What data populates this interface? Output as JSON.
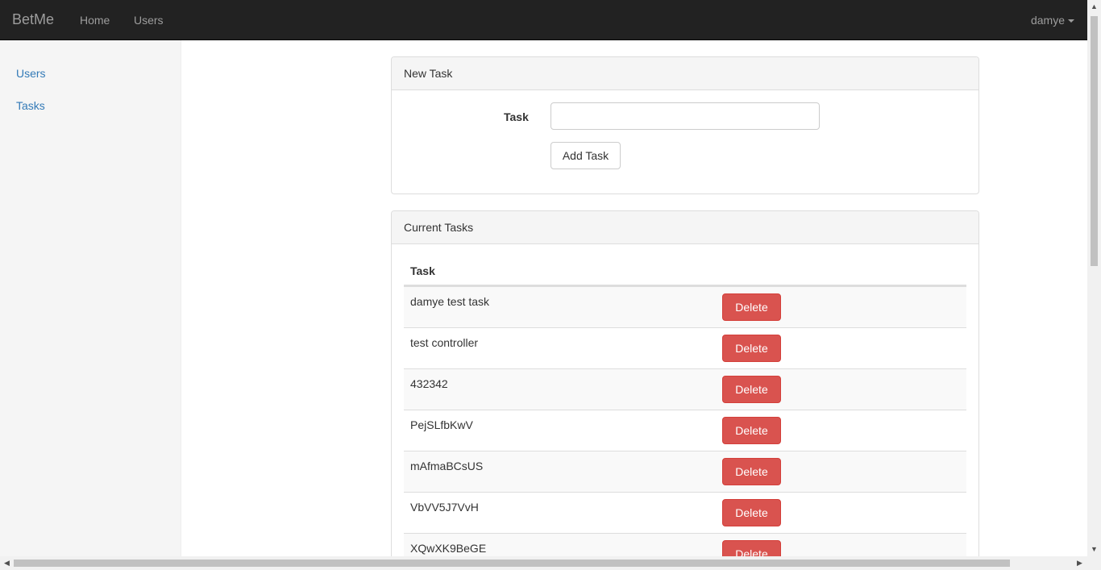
{
  "navbar": {
    "brand": "BetMe",
    "links": [
      "Home",
      "Users"
    ],
    "user": "damye"
  },
  "sidebar": {
    "items": [
      "Users",
      "Tasks"
    ]
  },
  "new_task_panel": {
    "heading": "New Task",
    "label": "Task",
    "input_value": "",
    "button": "Add Task"
  },
  "current_tasks_panel": {
    "heading": "Current Tasks",
    "column": "Task",
    "delete_label": "Delete",
    "rows": [
      "damye test task",
      "test controller",
      "432342",
      "PejSLfbKwV",
      "mAfmaBCsUS",
      "VbVV5J7VvH",
      "XQwXK9BeGE"
    ]
  },
  "colors": {
    "navbar_bg": "#222222",
    "link": "#337ab7",
    "danger": "#d9534f"
  }
}
